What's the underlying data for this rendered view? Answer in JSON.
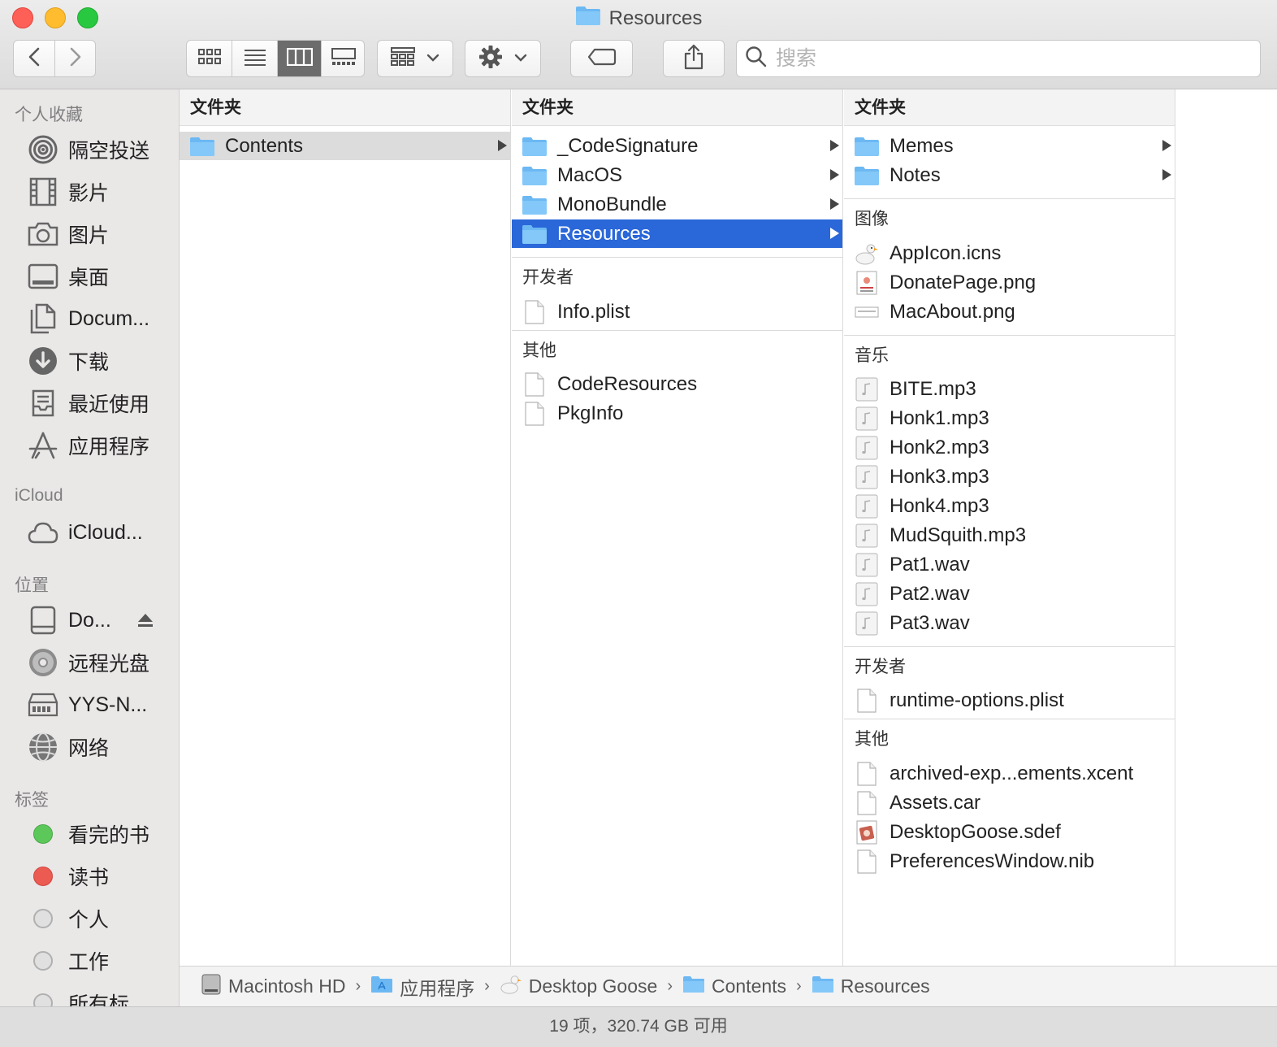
{
  "window": {
    "title": "Resources",
    "search_placeholder": "搜索"
  },
  "sidebar": {
    "favorites_header": "个人收藏",
    "favorites": [
      {
        "label": "隔空投送",
        "icon": "airdrop-icon"
      },
      {
        "label": "影片",
        "icon": "film-icon"
      },
      {
        "label": "图片",
        "icon": "camera-icon"
      },
      {
        "label": "桌面",
        "icon": "desktop-icon"
      },
      {
        "label": "Docum...",
        "icon": "documents-icon"
      },
      {
        "label": "下载",
        "icon": "download-icon"
      },
      {
        "label": "最近使用",
        "icon": "recents-icon"
      },
      {
        "label": "应用程序",
        "icon": "applications-icon"
      }
    ],
    "icloud_header": "iCloud",
    "icloud": [
      {
        "label": "iCloud...",
        "icon": "cloud-icon"
      }
    ],
    "locations_header": "位置",
    "locations": [
      {
        "label": "Do...",
        "icon": "disk-icon"
      },
      {
        "label": "远程光盘",
        "icon": "optical-disc-icon"
      },
      {
        "label": "YYS-N...",
        "icon": "server-icon"
      },
      {
        "label": "网络",
        "icon": "network-icon"
      }
    ],
    "tags_header": "标签",
    "tags": [
      {
        "label": "看完的书",
        "color": "#5cc85a"
      },
      {
        "label": "读书",
        "color": "#ec5b52"
      },
      {
        "label": "个人",
        "color": "#e0e0e0"
      },
      {
        "label": "工作",
        "color": "#e0e0e0"
      },
      {
        "label": "所有标",
        "color": "#e0e0e0"
      }
    ]
  },
  "columns": {
    "col1": {
      "header": "文件夹",
      "items": [
        {
          "label": "Contents"
        }
      ]
    },
    "col2": {
      "folder_header": "文件夹",
      "folders": [
        {
          "label": "_CodeSignature"
        },
        {
          "label": "MacOS"
        },
        {
          "label": "MonoBundle"
        },
        {
          "label": "Resources"
        }
      ],
      "developer_header": "开发者",
      "developer": [
        {
          "label": "Info.plist"
        }
      ],
      "other_header": "其他",
      "other": [
        {
          "label": "CodeResources"
        },
        {
          "label": "PkgInfo"
        }
      ]
    },
    "col3": {
      "folder_header": "文件夹",
      "folders": [
        {
          "label": "Memes"
        },
        {
          "label": "Notes"
        }
      ],
      "images_header": "图像",
      "images": [
        {
          "label": "AppIcon.icns"
        },
        {
          "label": "DonatePage.png"
        },
        {
          "label": "MacAbout.png"
        }
      ],
      "music_header": "音乐",
      "music": [
        {
          "label": "BITE.mp3"
        },
        {
          "label": "Honk1.mp3"
        },
        {
          "label": "Honk2.mp3"
        },
        {
          "label": "Honk3.mp3"
        },
        {
          "label": "Honk4.mp3"
        },
        {
          "label": "MudSquith.mp3"
        },
        {
          "label": "Pat1.wav"
        },
        {
          "label": "Pat2.wav"
        },
        {
          "label": "Pat3.wav"
        }
      ],
      "developer_header": "开发者",
      "developer": [
        {
          "label": "runtime-options.plist"
        }
      ],
      "other_header": "其他",
      "other": [
        {
          "label": "archived-exp...ements.xcent"
        },
        {
          "label": "Assets.car"
        },
        {
          "label": "DesktopGoose.sdef"
        },
        {
          "label": "PreferencesWindow.nib"
        }
      ]
    }
  },
  "pathbar": [
    {
      "label": "Macintosh HD",
      "icon": "hard-drive-icon"
    },
    {
      "label": "应用程序",
      "icon": "applications-folder-icon"
    },
    {
      "label": "Desktop Goose",
      "icon": "goose-app-icon"
    },
    {
      "label": "Contents",
      "icon": "folder-icon"
    },
    {
      "label": "Resources",
      "icon": "folder-icon"
    }
  ],
  "status": "19 项，320.74 GB 可用",
  "colors": {
    "selection": "#2a67d9",
    "folder": "#6cb8f3",
    "close": "#fe5f57",
    "minimize": "#febc2e",
    "zoom": "#28c840"
  }
}
